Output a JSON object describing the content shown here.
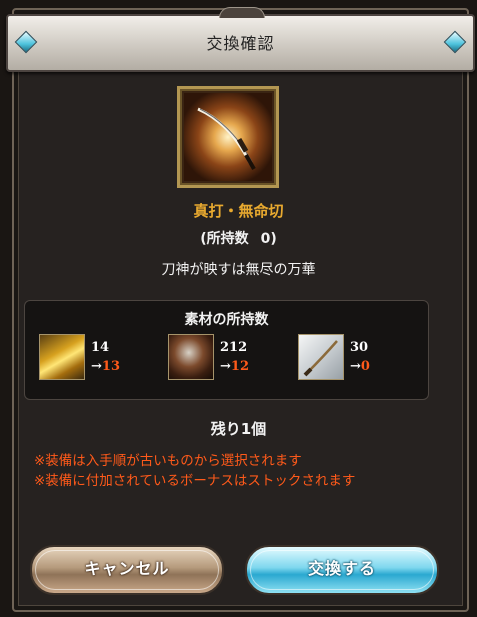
{
  "dialog": {
    "title": "交換確認",
    "item_name": "真打・無命切",
    "owned_label": "(所持数",
    "owned_count": "0)",
    "flavor_text": "刀神が映すは無尽の万華",
    "materials_title": "素材の所持数",
    "materials": [
      {
        "icon": "gold-ingot-icon",
        "current": "14",
        "arrow": "→",
        "after": "13"
      },
      {
        "icon": "dark-orb-icon",
        "current": "212",
        "arrow": "→",
        "after": "12"
      },
      {
        "icon": "blade-icon",
        "current": "30",
        "arrow": "→",
        "after": "0"
      }
    ],
    "remaining": "残り1個",
    "notes": [
      "※装備は入手順が古いものから選択されます",
      "※装備に付加されているボーナスはストックされます"
    ],
    "cancel_label": "キャンセル",
    "exchange_label": "交換する"
  },
  "colors": {
    "accent_gold": "#e9aa2f",
    "warning_orange": "#ff5a1a",
    "exchange_button": "#2aa8d0"
  }
}
